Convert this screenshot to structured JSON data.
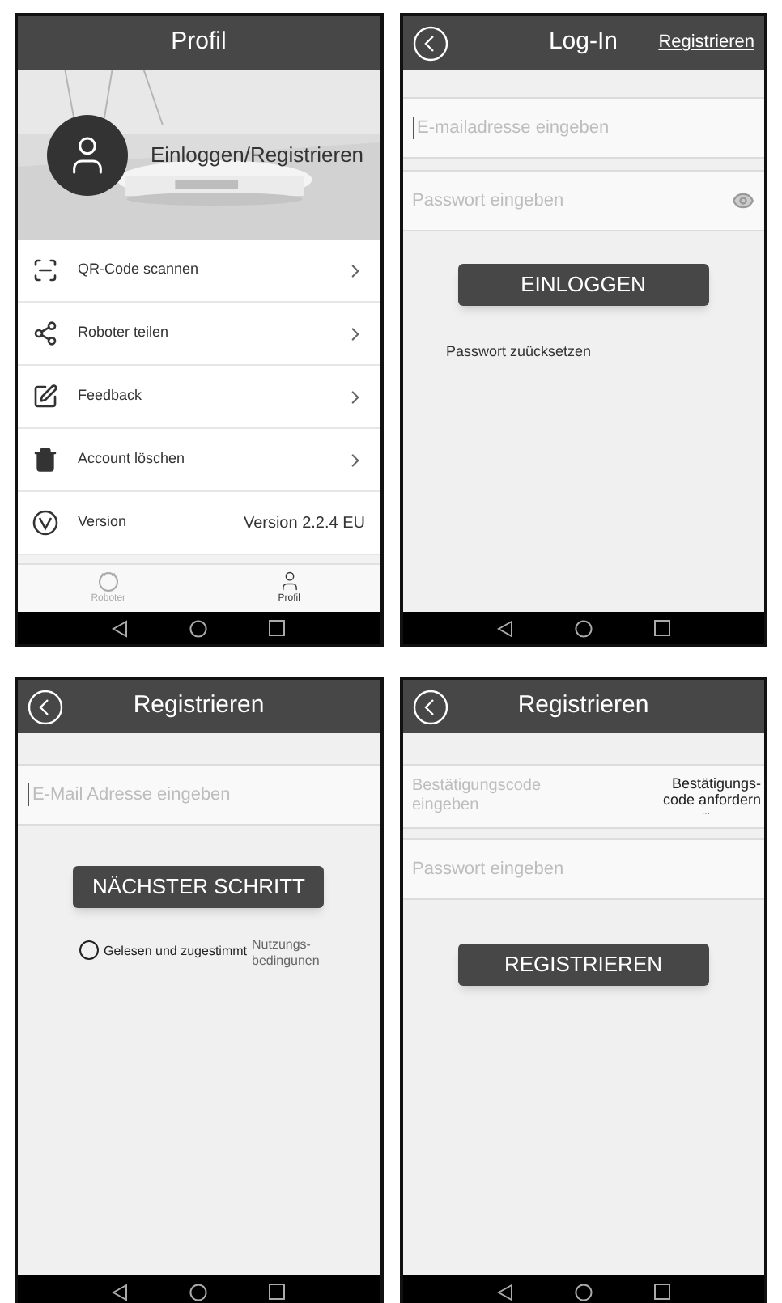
{
  "screens": [
    {
      "kind": "profile",
      "header": {
        "title": "Profil",
        "back": false
      },
      "hero": {
        "kind": "picture",
        "label": "Einloggen/Registrieren"
      },
      "menu": [
        {
          "kind": "link",
          "label": "QR-Code scannen"
        },
        {
          "kind": "link",
          "label": "Roboter teilen"
        },
        {
          "kind": "link",
          "label": "Feedback"
        },
        {
          "kind": "link",
          "label": "Account löschen"
        },
        {
          "kind": "info",
          "label": "Version",
          "value": "Version 2.2.4 EU"
        }
      ],
      "tabs": [
        {
          "label": "Roboter",
          "selected": false
        },
        {
          "label": "Profil",
          "selected": true
        }
      ]
    },
    {
      "kind": "login",
      "header": {
        "title": "Log-In",
        "back": true,
        "action": "Registrieren"
      },
      "fields": [
        {
          "placeholder": "E-mailadresse eingeben",
          "focused": true,
          "eye": false
        },
        {
          "placeholder": "Passwort eingeben",
          "focused": false,
          "eye": true
        }
      ],
      "button": "EINLOGGEN",
      "link": "Passwort zuücksetzen"
    },
    {
      "kind": "register_email",
      "header": {
        "title": "Registrieren",
        "back": true
      },
      "fields": [
        {
          "placeholder": "E-Mail Adresse eingeben",
          "focused": true,
          "eye": false
        }
      ],
      "button": "NÄCHSTER SCHRITT",
      "agreement": {
        "label": "Gelesen und zugestimmt",
        "checked": false,
        "link": "Nutzungs-bedingunen"
      }
    },
    {
      "kind": "register_code",
      "header": {
        "title": "Registrieren",
        "back": true
      },
      "code_field": {
        "placeholder": "Bestätigungscode eingeben",
        "action": "Bestätigungs-code anfordern",
        "indicator": "..."
      },
      "fields": [
        {
          "placeholder": "Passwort eingeben",
          "focused": false,
          "eye": false
        }
      ],
      "button": "REGISTRIEREN"
    }
  ]
}
